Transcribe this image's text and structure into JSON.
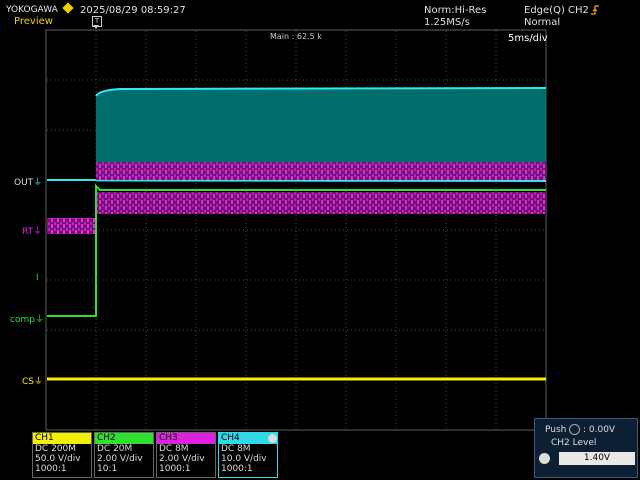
{
  "header": {
    "brand": "YOKOGAWA",
    "mode": "Preview",
    "datetime": "2025/08/29 08:59:27",
    "trigger_position_marker": "T",
    "acquisition_mode": "Norm:Hi-Res",
    "sample_rate": "1.25MS/s",
    "trigger_source": "Edge(Q) CH2",
    "trigger_mode": "Normal"
  },
  "display": {
    "main_label": "Main : 62.5 k",
    "timebase": "5ms/div"
  },
  "channel_markers": {
    "out": "OUT",
    "rt": "RT",
    "i": "I",
    "comp": "comp",
    "cs": "CS"
  },
  "channels": [
    {
      "id": "CH1",
      "coupling": "DC 200M",
      "scale": "50.0 V/div",
      "probe": "1000:1",
      "color": "#f0f000"
    },
    {
      "id": "CH2",
      "coupling": "DC 20M",
      "scale": "2.00 V/div",
      "probe": "10:1",
      "color": "#30e030"
    },
    {
      "id": "CH3",
      "coupling": "DC 8M",
      "scale": "2.00 V/div",
      "probe": "1000:1",
      "color": "#e020e0"
    },
    {
      "id": "CH4",
      "coupling": "DC 8M",
      "scale": "10.0 V/div",
      "probe": "1000:1",
      "color": "#30d8e8"
    }
  ],
  "trigger_panel": {
    "push_label": "Push",
    "push_value": ": 0.00V",
    "level_title": "CH2 Level",
    "level_value": "1.40V"
  },
  "icons": {
    "logo": "yokogawa-diamond",
    "trigger_edge": "rising-edge-icon",
    "ground_marker": "ground-icon",
    "jog_dial": "jog-dial-icon"
  },
  "colors": {
    "ch1": "#f0f000",
    "ch2": "#30e030",
    "ch3": "#e020e0",
    "ch4": "#30d8e8",
    "ch4_fill": "#008080",
    "background": "#000000",
    "grid": "#4a4a4a"
  }
}
